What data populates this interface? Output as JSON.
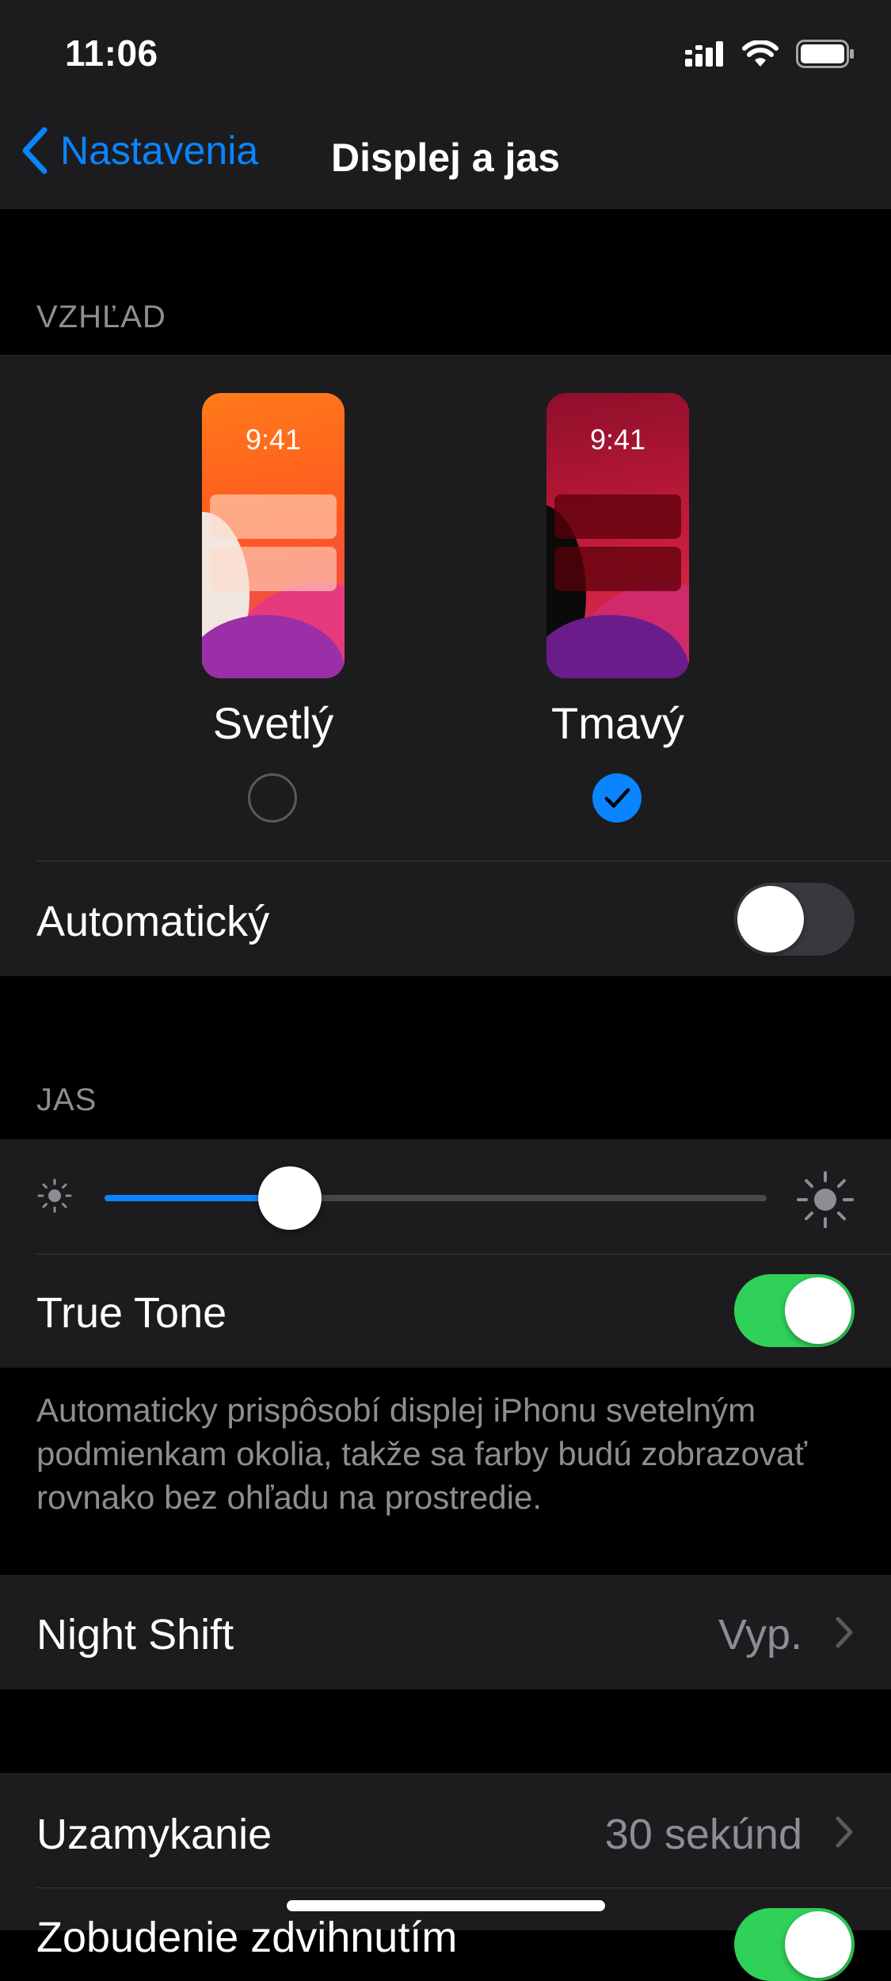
{
  "status_bar": {
    "time": "11:06"
  },
  "nav": {
    "back_label": "Nastavenia",
    "title": "Displej a jas"
  },
  "appearance": {
    "header": "VZHĽAD",
    "preview_time": "9:41",
    "options": [
      {
        "label": "Svetlý",
        "selected": false
      },
      {
        "label": "Tmavý",
        "selected": true
      }
    ],
    "automatic_label": "Automatický",
    "automatic_on": false
  },
  "brightness": {
    "header": "JAS",
    "level": 0.28,
    "true_tone_label": "True Tone",
    "true_tone_on": true,
    "description": "Automaticky prispôsobí displej iPhonu svetelným podmienkam okolia, takže sa farby budú zobrazovať rovnako bez ohľadu na prostredie."
  },
  "night_shift": {
    "label": "Night Shift",
    "value": "Vyp."
  },
  "auto_lock": {
    "label": "Uzamykanie",
    "value": "30 sekúnd"
  },
  "next_row": {
    "label": "Zobudenie zdvihnutím",
    "on": true
  },
  "colors": {
    "accent": "#0a84ff",
    "toggle_on": "#30d158",
    "toggle_off": "#39393d"
  }
}
